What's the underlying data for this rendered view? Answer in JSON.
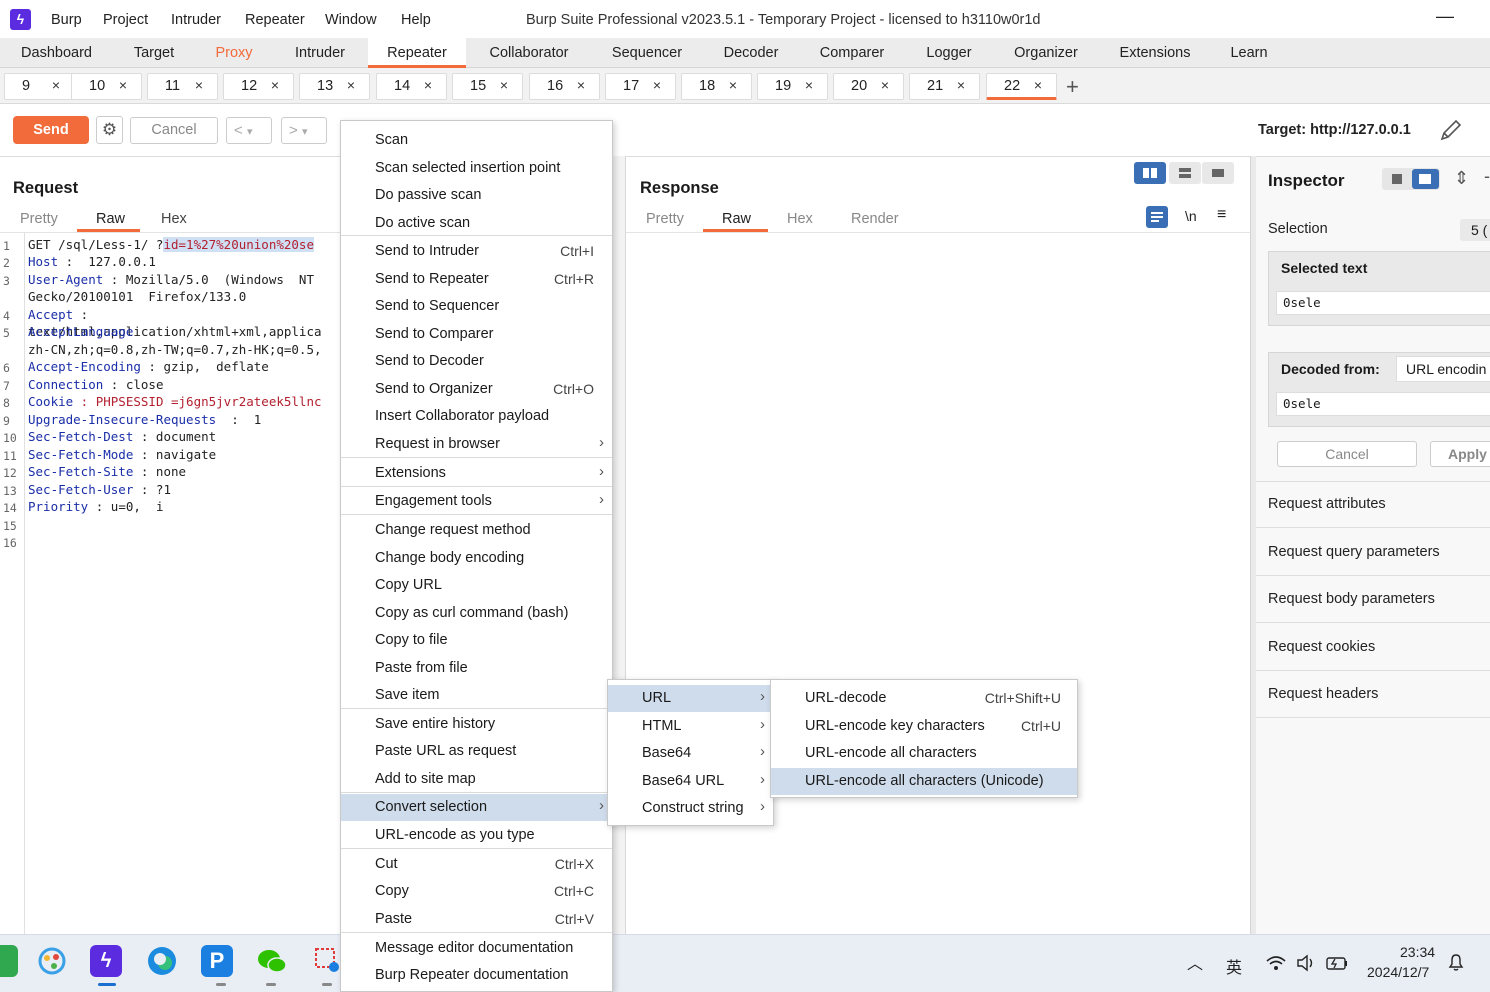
{
  "menubar": {
    "items": [
      "Burp",
      "Project",
      "Intruder",
      "Repeater",
      "Window",
      "Help"
    ],
    "title": "Burp Suite Professional v2023.5.1 - Temporary Project - licensed to h3110w0r1d",
    "minimize": "—"
  },
  "main_tabs": [
    "Dashboard",
    "Target",
    "Proxy",
    "Intruder",
    "Repeater",
    "Collaborator",
    "Sequencer",
    "Decoder",
    "Comparer",
    "Logger",
    "Organizer",
    "Extensions",
    "Learn"
  ],
  "repeater_tabs": [
    "9",
    "10",
    "11",
    "12",
    "13",
    "14",
    "15",
    "16",
    "17",
    "18",
    "19",
    "20",
    "21",
    "22"
  ],
  "tab_close": "×",
  "add_tab": "+",
  "toolbar": {
    "send": "Send",
    "cancel": "Cancel",
    "prev": "<",
    "next": ">",
    "dropdown": "▾",
    "target": "Target: http://127.0.0.1"
  },
  "request": {
    "title": "Request",
    "tabs": [
      "Pretty",
      "Raw",
      "Hex"
    ],
    "line_numbers": [
      "1",
      "2",
      "3",
      "",
      "4",
      "5",
      "",
      "6",
      "7",
      "8",
      "9",
      "10",
      "11",
      "12",
      "13",
      "14",
      "15",
      "16"
    ],
    "lines": [
      {
        "k": "GET /sql/Less-1/ ?",
        "v": "id=1%27%20union%20se"
      },
      {
        "k": "Host",
        "v": " :  127.0.0.1"
      },
      {
        "k": "User-Agent",
        "v": " : Mozilla/5.0  (Windows  NT"
      },
      {
        "k": "",
        "v": "Gecko/20100101  Firefox/133.0"
      },
      {
        "k": "Accept",
        "v": " :"
      },
      {
        "k": "AcceptLanguage",
        "v": "text/html,application/xhtml+xml,applica"
      },
      {
        "k": "",
        "v": "zh-CN,zh;q=0.8,zh-TW;q=0.7,zh-HK;q=0.5,"
      },
      {
        "k": "Accept-Encoding",
        "v": " : gzip,  deflate"
      },
      {
        "k": "Connection",
        "v": " : close"
      },
      {
        "k": "Cookie",
        "v": " : PHPSESSID =j6gn5jvr2ateek5llnc"
      },
      {
        "k": "Upgrade-Insecure-Requests",
        "v": "  :  1"
      },
      {
        "k": "Sec-Fetch-Dest",
        "v": " : document"
      },
      {
        "k": "Sec-Fetch-Mode",
        "v": " : navigate"
      },
      {
        "k": "Sec-Fetch-Site",
        "v": " : none"
      },
      {
        "k": "Sec-Fetch-User",
        "v": " : ?1"
      },
      {
        "k": "Priority",
        "v": " : u=0,  i"
      }
    ]
  },
  "response": {
    "title": "Response",
    "tabs": [
      "Pretty",
      "Raw",
      "Hex",
      "Render"
    ],
    "newline_toggle": "\\n"
  },
  "inspector": {
    "title": "Inspector",
    "selection_label": "Selection",
    "selection_count": "5 (",
    "selected_text_label": "Selected text",
    "selected_text_value": "0sele",
    "decoded_from_label": "Decoded from:",
    "decoded_from_value": "URL encodin",
    "decoded_value": "0sele",
    "cancel": "Cancel",
    "apply": "Apply",
    "sections": [
      "Request attributes",
      "Request query parameters",
      "Request body parameters",
      "Request cookies",
      "Request headers"
    ]
  },
  "context_menu": {
    "items": [
      {
        "label": "Scan",
        "shortcut": ""
      },
      {
        "label": "Scan selected insertion point",
        "shortcut": ""
      },
      {
        "label": "Do passive scan",
        "shortcut": ""
      },
      {
        "label": "Do active scan",
        "shortcut": ""
      },
      {
        "label": "Send to Intruder",
        "shortcut": "Ctrl+I"
      },
      {
        "label": "Send to Repeater",
        "shortcut": "Ctrl+R"
      },
      {
        "label": "Send to Sequencer",
        "shortcut": ""
      },
      {
        "label": "Send to Comparer",
        "shortcut": ""
      },
      {
        "label": "Send to Decoder",
        "shortcut": ""
      },
      {
        "label": "Send to Organizer",
        "shortcut": "Ctrl+O"
      },
      {
        "label": "Insert Collaborator payload",
        "shortcut": ""
      },
      {
        "label": "Request in browser",
        "shortcut": ""
      },
      {
        "label": "Extensions",
        "shortcut": ""
      },
      {
        "label": "Engagement tools",
        "shortcut": ""
      },
      {
        "label": "Change request method",
        "shortcut": ""
      },
      {
        "label": "Change body encoding",
        "shortcut": ""
      },
      {
        "label": "Copy URL",
        "shortcut": ""
      },
      {
        "label": "Copy as curl command (bash)",
        "shortcut": ""
      },
      {
        "label": "Copy to file",
        "shortcut": ""
      },
      {
        "label": "Paste from file",
        "shortcut": ""
      },
      {
        "label": "Save item",
        "shortcut": ""
      },
      {
        "label": "Save entire history",
        "shortcut": ""
      },
      {
        "label": "Paste URL as request",
        "shortcut": ""
      },
      {
        "label": "Add to site map",
        "shortcut": ""
      },
      {
        "label": "Convert selection",
        "shortcut": ""
      },
      {
        "label": "URL-encode as you type",
        "shortcut": ""
      },
      {
        "label": "Cut",
        "shortcut": "Ctrl+X"
      },
      {
        "label": "Copy",
        "shortcut": "Ctrl+C"
      },
      {
        "label": "Paste",
        "shortcut": "Ctrl+V"
      },
      {
        "label": "Message editor documentation",
        "shortcut": ""
      },
      {
        "label": "Burp Repeater documentation",
        "shortcut": ""
      }
    ],
    "submenu_arrow": "›"
  },
  "convert_submenu": [
    "URL",
    "HTML",
    "Base64",
    "Base64 URL",
    "Construct string"
  ],
  "url_submenu": [
    {
      "label": "URL-decode",
      "shortcut": "Ctrl+Shift+U"
    },
    {
      "label": "URL-encode key characters",
      "shortcut": "Ctrl+U"
    },
    {
      "label": "URL-encode all characters",
      "shortcut": ""
    },
    {
      "label": "URL-encode all characters (Unicode)",
      "shortcut": ""
    }
  ],
  "taskbar": {
    "time": "23:34",
    "date": "2024/12/7",
    "ime": "英",
    "chevron": "︿",
    "bell": "🔔"
  }
}
